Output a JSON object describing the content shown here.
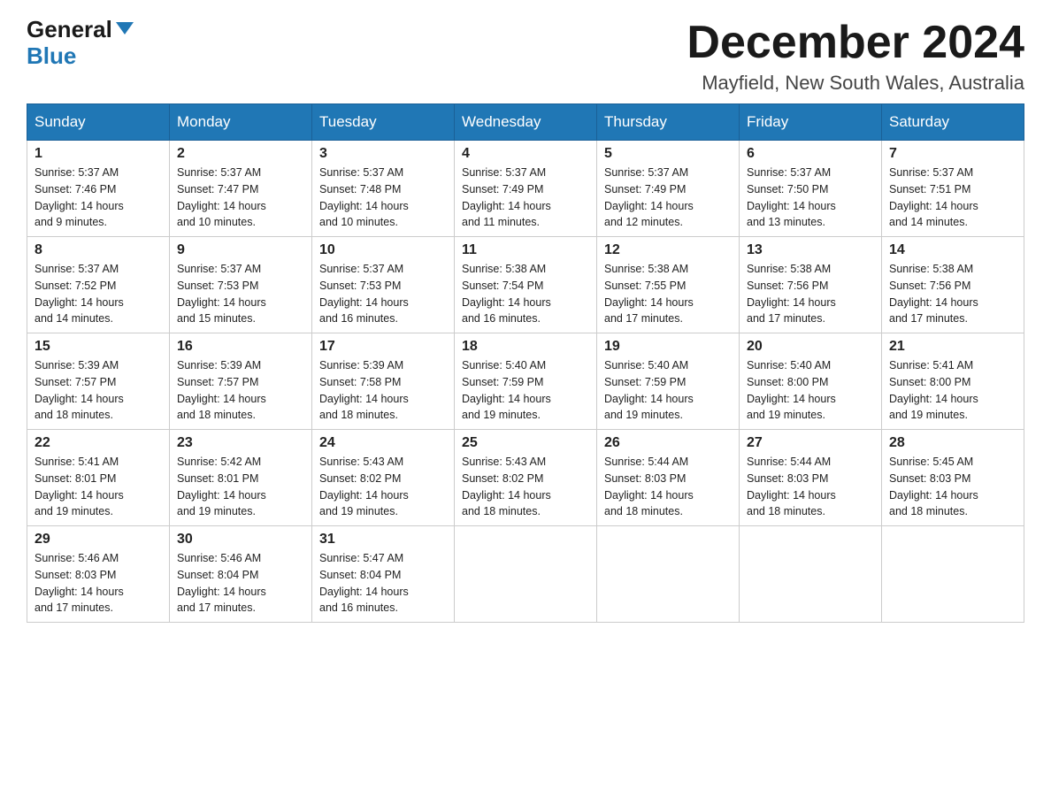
{
  "header": {
    "logo_general": "General",
    "logo_blue": "Blue",
    "month_title": "December 2024",
    "location": "Mayfield, New South Wales, Australia"
  },
  "days_of_week": [
    "Sunday",
    "Monday",
    "Tuesday",
    "Wednesday",
    "Thursday",
    "Friday",
    "Saturday"
  ],
  "weeks": [
    [
      {
        "day": "1",
        "sunrise": "5:37 AM",
        "sunset": "7:46 PM",
        "daylight": "14 hours and 9 minutes."
      },
      {
        "day": "2",
        "sunrise": "5:37 AM",
        "sunset": "7:47 PM",
        "daylight": "14 hours and 10 minutes."
      },
      {
        "day": "3",
        "sunrise": "5:37 AM",
        "sunset": "7:48 PM",
        "daylight": "14 hours and 10 minutes."
      },
      {
        "day": "4",
        "sunrise": "5:37 AM",
        "sunset": "7:49 PM",
        "daylight": "14 hours and 11 minutes."
      },
      {
        "day": "5",
        "sunrise": "5:37 AM",
        "sunset": "7:49 PM",
        "daylight": "14 hours and 12 minutes."
      },
      {
        "day": "6",
        "sunrise": "5:37 AM",
        "sunset": "7:50 PM",
        "daylight": "14 hours and 13 minutes."
      },
      {
        "day": "7",
        "sunrise": "5:37 AM",
        "sunset": "7:51 PM",
        "daylight": "14 hours and 14 minutes."
      }
    ],
    [
      {
        "day": "8",
        "sunrise": "5:37 AM",
        "sunset": "7:52 PM",
        "daylight": "14 hours and 14 minutes."
      },
      {
        "day": "9",
        "sunrise": "5:37 AM",
        "sunset": "7:53 PM",
        "daylight": "14 hours and 15 minutes."
      },
      {
        "day": "10",
        "sunrise": "5:37 AM",
        "sunset": "7:53 PM",
        "daylight": "14 hours and 16 minutes."
      },
      {
        "day": "11",
        "sunrise": "5:38 AM",
        "sunset": "7:54 PM",
        "daylight": "14 hours and 16 minutes."
      },
      {
        "day": "12",
        "sunrise": "5:38 AM",
        "sunset": "7:55 PM",
        "daylight": "14 hours and 17 minutes."
      },
      {
        "day": "13",
        "sunrise": "5:38 AM",
        "sunset": "7:56 PM",
        "daylight": "14 hours and 17 minutes."
      },
      {
        "day": "14",
        "sunrise": "5:38 AM",
        "sunset": "7:56 PM",
        "daylight": "14 hours and 17 minutes."
      }
    ],
    [
      {
        "day": "15",
        "sunrise": "5:39 AM",
        "sunset": "7:57 PM",
        "daylight": "14 hours and 18 minutes."
      },
      {
        "day": "16",
        "sunrise": "5:39 AM",
        "sunset": "7:57 PM",
        "daylight": "14 hours and 18 minutes."
      },
      {
        "day": "17",
        "sunrise": "5:39 AM",
        "sunset": "7:58 PM",
        "daylight": "14 hours and 18 minutes."
      },
      {
        "day": "18",
        "sunrise": "5:40 AM",
        "sunset": "7:59 PM",
        "daylight": "14 hours and 19 minutes."
      },
      {
        "day": "19",
        "sunrise": "5:40 AM",
        "sunset": "7:59 PM",
        "daylight": "14 hours and 19 minutes."
      },
      {
        "day": "20",
        "sunrise": "5:40 AM",
        "sunset": "8:00 PM",
        "daylight": "14 hours and 19 minutes."
      },
      {
        "day": "21",
        "sunrise": "5:41 AM",
        "sunset": "8:00 PM",
        "daylight": "14 hours and 19 minutes."
      }
    ],
    [
      {
        "day": "22",
        "sunrise": "5:41 AM",
        "sunset": "8:01 PM",
        "daylight": "14 hours and 19 minutes."
      },
      {
        "day": "23",
        "sunrise": "5:42 AM",
        "sunset": "8:01 PM",
        "daylight": "14 hours and 19 minutes."
      },
      {
        "day": "24",
        "sunrise": "5:43 AM",
        "sunset": "8:02 PM",
        "daylight": "14 hours and 19 minutes."
      },
      {
        "day": "25",
        "sunrise": "5:43 AM",
        "sunset": "8:02 PM",
        "daylight": "14 hours and 18 minutes."
      },
      {
        "day": "26",
        "sunrise": "5:44 AM",
        "sunset": "8:03 PM",
        "daylight": "14 hours and 18 minutes."
      },
      {
        "day": "27",
        "sunrise": "5:44 AM",
        "sunset": "8:03 PM",
        "daylight": "14 hours and 18 minutes."
      },
      {
        "day": "28",
        "sunrise": "5:45 AM",
        "sunset": "8:03 PM",
        "daylight": "14 hours and 18 minutes."
      }
    ],
    [
      {
        "day": "29",
        "sunrise": "5:46 AM",
        "sunset": "8:03 PM",
        "daylight": "14 hours and 17 minutes."
      },
      {
        "day": "30",
        "sunrise": "5:46 AM",
        "sunset": "8:04 PM",
        "daylight": "14 hours and 17 minutes."
      },
      {
        "day": "31",
        "sunrise": "5:47 AM",
        "sunset": "8:04 PM",
        "daylight": "14 hours and 16 minutes."
      },
      null,
      null,
      null,
      null
    ]
  ],
  "labels": {
    "sunrise_label": "Sunrise:",
    "sunset_label": "Sunset:",
    "daylight_label": "Daylight:"
  }
}
